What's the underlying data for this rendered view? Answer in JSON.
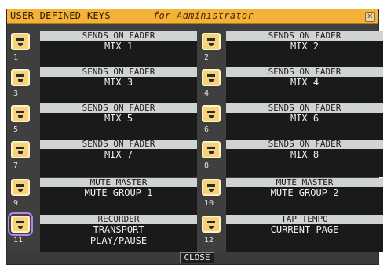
{
  "window": {
    "title": "USER DEFINED KEYS",
    "subtitle": "for Administrator"
  },
  "keys": [
    {
      "num": "1",
      "func": "SENDS ON FADER",
      "param": [
        "MIX 1"
      ]
    },
    {
      "num": "2",
      "func": "SENDS ON FADER",
      "param": [
        "MIX 2"
      ]
    },
    {
      "num": "3",
      "func": "SENDS ON FADER",
      "param": [
        "MIX 3"
      ]
    },
    {
      "num": "4",
      "func": "SENDS ON FADER",
      "param": [
        "MIX 4"
      ]
    },
    {
      "num": "5",
      "func": "SENDS ON FADER",
      "param": [
        "MIX 5"
      ]
    },
    {
      "num": "6",
      "func": "SENDS ON FADER",
      "param": [
        "MIX 6"
      ]
    },
    {
      "num": "7",
      "func": "SENDS ON FADER",
      "param": [
        "MIX 7"
      ]
    },
    {
      "num": "8",
      "func": "SENDS ON FADER",
      "param": [
        "MIX 8"
      ]
    },
    {
      "num": "9",
      "func": "MUTE MASTER",
      "param": [
        "MUTE GROUP 1"
      ]
    },
    {
      "num": "10",
      "func": "MUTE MASTER",
      "param": [
        "MUTE GROUP 2"
      ]
    },
    {
      "num": "11",
      "func": "RECORDER",
      "param": [
        "TRANSPORT",
        "PLAY/PAUSE"
      ]
    },
    {
      "num": "12",
      "func": "TAP TEMPO",
      "param": [
        "CURRENT PAGE"
      ]
    }
  ],
  "footer": {
    "close_label": "CLOSE"
  },
  "colors": {
    "titlebar": "#f4b23a",
    "key": "#f6d37a",
    "selected_outline": "#b388e8"
  }
}
